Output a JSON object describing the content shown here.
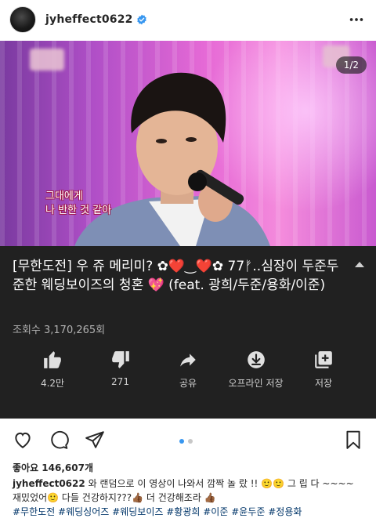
{
  "header": {
    "username": "jyheffect0622",
    "verified": true,
    "icons": {
      "avatar": "profile-avatar",
      "verified": "verified-badge-icon",
      "more": "more-options-icon"
    }
  },
  "media": {
    "page_counter": "1/2",
    "subtitle_line1": "그대에게",
    "subtitle_line2": "나 반한 것 같아",
    "video_title": "[무한도전] 우 쥬 메리미? ✿❤️‿❤️✿ 77ᚠ..심장이 두준두준한 웨딩보이즈의 청혼 💖 (feat. 광희/두준/용화/이준)",
    "view_count": "조회수 3,170,265회",
    "actions": [
      {
        "icon": "thumbs-up-icon",
        "label": "4.2만"
      },
      {
        "icon": "thumbs-down-icon",
        "label": "271"
      },
      {
        "icon": "share-icon",
        "label": "공유"
      },
      {
        "icon": "download-icon",
        "label": "오프라인 저장"
      },
      {
        "icon": "add-to-playlist-icon",
        "label": "저장"
      }
    ],
    "colors": {
      "panel": "#212121",
      "text": "#ffffff",
      "muted": "#b0b0b0"
    }
  },
  "post_actions": {
    "icons": [
      "heart-icon",
      "comment-icon",
      "send-icon",
      "bookmark-icon"
    ],
    "carousel": {
      "count": 2,
      "active": 1,
      "active_color": "#3897f0"
    }
  },
  "likes": "좋아요 146,607개",
  "caption": {
    "username": "jyheffect0622",
    "text": "와 랜덤으로 이 영상이 나와서 깜짝 놀 랐 !! 🙂🙂 그 립 다 ~~~~ 재밌었어🙂 다들 건강하지???👍🏾 더 건강해조라 👍🏾",
    "hashtags": [
      "#무한도전",
      "#웨딩싱어즈",
      "#웨딩보이즈",
      "#황광희",
      "#이준",
      "#윤두준",
      "#정용화"
    ]
  }
}
